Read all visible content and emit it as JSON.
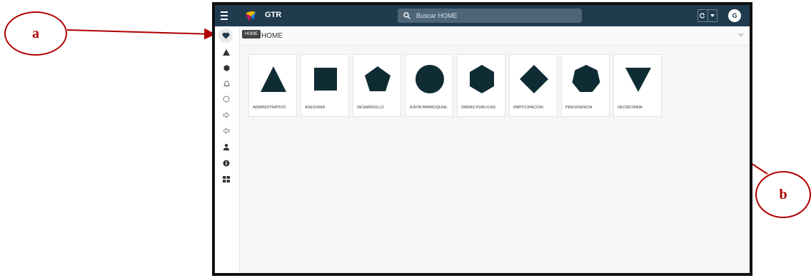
{
  "annotations": {
    "a": "a",
    "b": "b"
  },
  "topbar": {
    "title": "GTR",
    "search_placeholder": "Buscar HOME",
    "refresh_icon": "refresh-icon",
    "dropdown_icon": "caret-down-icon",
    "avatar_initial": "G",
    "color": "#203a4e"
  },
  "tooltip": "HOME",
  "breadcrumb": "HOME",
  "sidebar": {
    "icons": [
      "heart-icon",
      "triangle-icon",
      "hexagon-icon",
      "bell-icon",
      "circle-icon",
      "arrow-right-icon",
      "arrow-left-icon",
      "user-icon",
      "info-icon",
      "grid-icon"
    ]
  },
  "tiles": [
    {
      "label": "ADMINISTRATIVO",
      "shape": "triangle"
    },
    {
      "label": "ASESORIA",
      "shape": "square"
    },
    {
      "label": "DESARROLLO",
      "shape": "pentagon"
    },
    {
      "label": "JUNTA PARROQUIAL",
      "shape": "circle"
    },
    {
      "label": "OBRAS PUBLICAS",
      "shape": "hexagon"
    },
    {
      "label": "PARTICIPACION",
      "shape": "diamond"
    },
    {
      "label": "PRESIDENCIA",
      "shape": "heptagon"
    },
    {
      "label": "SECRETARIA",
      "shape": "inverted-triangle"
    }
  ],
  "colors": {
    "shape": "#0f2b34",
    "annotation": "#b00000"
  }
}
